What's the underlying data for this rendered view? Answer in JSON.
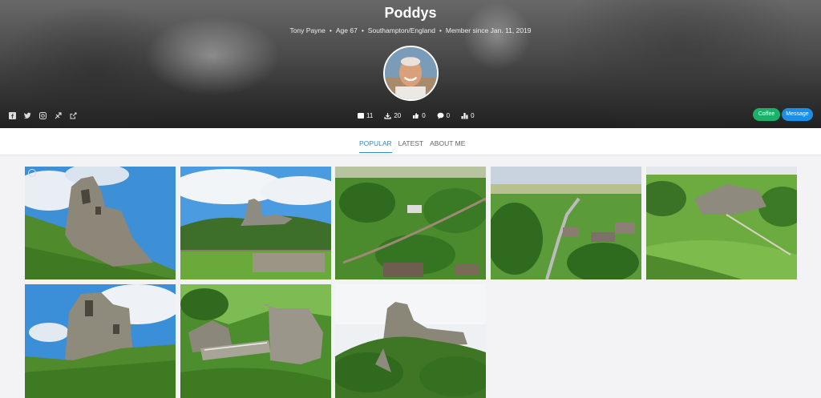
{
  "profile": {
    "username": "Poddys",
    "real_name": "Tony Payne",
    "age": "Age 67",
    "location": "Southampton/England",
    "member_since": "Member since Jan. 11, 2019"
  },
  "social_icons": [
    "facebook-icon",
    "twitter-icon",
    "instagram-icon",
    "flickr-icon",
    "external-link-icon"
  ],
  "stats": {
    "photos": "11",
    "downloads": "20",
    "likes": "0",
    "comments": "0",
    "rank": "0"
  },
  "buttons": {
    "coffee": "Coffee",
    "message": "Message"
  },
  "tabs": [
    {
      "label": "POPULAR",
      "active": true
    },
    {
      "label": "LATEST",
      "active": false
    },
    {
      "label": "ABOUT ME",
      "active": false
    }
  ],
  "colors": {
    "accent": "#2c8dc8",
    "coffee": "#1ab26b",
    "message": "#1b8fe5"
  },
  "photos": [
    "castle-ruin-blue-sky",
    "castle-on-hill-distance",
    "village-aerial-railway",
    "village-valley-view",
    "castle-grounds-event",
    "castle-tower-clouds",
    "castle-bridge-gatehouse",
    "castle-hill-trees"
  ]
}
